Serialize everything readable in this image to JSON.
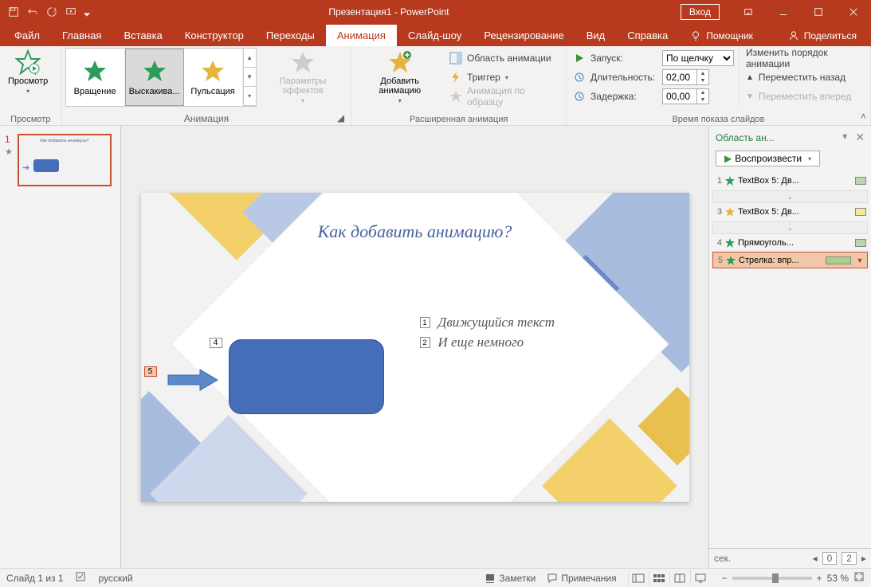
{
  "titlebar": {
    "title": "Презентация1 - PowerPoint",
    "signin": "Вход"
  },
  "tabs": {
    "file": "Файл",
    "home": "Главная",
    "insert": "Вставка",
    "design": "Конструктор",
    "transitions": "Переходы",
    "animation": "Анимация",
    "slideshow": "Слайд-шоу",
    "review": "Рецензирование",
    "view": "Вид",
    "help": "Справка",
    "assistant": "Помощник",
    "share": "Поделиться"
  },
  "ribbon": {
    "preview_group": "Просмотр",
    "preview_btn": "Просмотр",
    "anim_group": "Анимация",
    "gallery": [
      {
        "label": "Вращение",
        "color": "#2e9c5a"
      },
      {
        "label": "Выскакива...",
        "color": "#2e9c5a"
      },
      {
        "label": "Пульсация",
        "color": "#e6b33d"
      }
    ],
    "params": "Параметры эффектов",
    "ext_group": "Расширенная анимация",
    "add_anim": "Добавить анимацию",
    "anim_pane": "Область анимации",
    "trigger": "Триггер",
    "painter": "Анимация по образцу",
    "timing_group": "Время показа слайдов",
    "start": "Запуск:",
    "start_val": "По щелчку",
    "duration": "Длительность:",
    "duration_val": "02,00",
    "delay": "Задержка:",
    "delay_val": "00,00",
    "reorder": "Изменить порядок анимации",
    "move_back": "Переместить назад",
    "move_fwd": "Переместить вперед"
  },
  "thumb": {
    "num": "1"
  },
  "slide": {
    "title": "Как добавить анимацию?",
    "line1": "Движущийся текст",
    "line2": "И еще немного",
    "tag1": "1",
    "tag2": "2",
    "tag4": "4",
    "tag5": "5"
  },
  "animpane": {
    "title": "Область ан...",
    "play": "Воспроизвести",
    "items": [
      {
        "num": "1",
        "star": "#2e9c5a",
        "label": "TextBox 5: Дв...",
        "sw": "#b9d7a8"
      },
      {
        "num": "3",
        "star": "#e6b33d",
        "label": "TextBox 5: Дв...",
        "sw": "#f9e79f"
      },
      {
        "num": "4",
        "star": "#2e9c5a",
        "label": "Прямоуголь...",
        "sw": "#b9d7a8"
      },
      {
        "num": "5",
        "star": "#2e9c5a",
        "label": "Стрелка: впр...",
        "sw": "#a8d08d",
        "sel": true
      }
    ],
    "sec": "сек.",
    "pg0": "0",
    "pg2": "2"
  },
  "status": {
    "slide": "Слайд 1 из 1",
    "lang": "русский",
    "notes": "Заметки",
    "comments": "Примечания",
    "zoom": "53 %"
  }
}
